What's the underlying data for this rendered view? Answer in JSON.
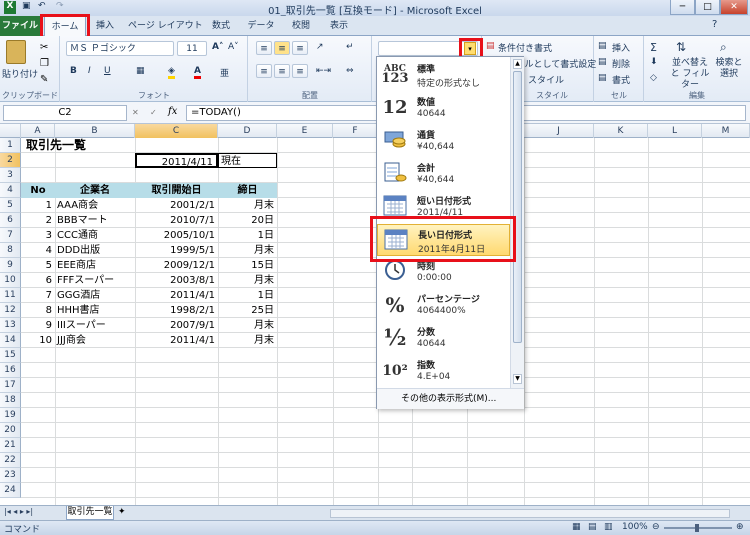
{
  "window": {
    "title": "01_取引先一覧 [互換モード] - Microsoft Excel"
  },
  "tabs": [
    "ファイル",
    "ホーム",
    "挿入",
    "ページ レイアウト",
    "数式",
    "データ",
    "校閲",
    "表示"
  ],
  "ribbon": {
    "clipboard": {
      "paste": "貼り付け",
      "label": "クリップボード"
    },
    "font": {
      "name": "ＭＳ Ｐゴシック",
      "size": "11",
      "label": "フォント"
    },
    "alignment": {
      "label": "配置"
    },
    "styles": {
      "conditional": "条件付き書式",
      "table": "テーブルとして書式設定",
      "cell": "スタイル",
      "label": "スタイル"
    },
    "cells": {
      "insert": "挿入",
      "delete": "削除",
      "format": "書式",
      "label": "セル"
    },
    "editing": {
      "sort": "並べ替えと フィルター",
      "find": "検索と 選択",
      "label": "編集"
    }
  },
  "formula_bar": {
    "name_box": "C2",
    "fx": "fx",
    "formula": "=TODAY()"
  },
  "columns": [
    "A",
    "B",
    "C",
    "D",
    "E",
    "F",
    "G",
    "H",
    "I",
    "J",
    "K",
    "L",
    "M"
  ],
  "rows": [
    "1",
    "2",
    "3",
    "4",
    "5",
    "6",
    "7",
    "8",
    "9",
    "10",
    "11",
    "12",
    "13",
    "14",
    "15",
    "16",
    "17",
    "18",
    "19",
    "20",
    "21",
    "22",
    "23",
    "24"
  ],
  "sheet": {
    "title": "取引先一覧",
    "c2": "2011/4/11",
    "d2": "現在",
    "headers": [
      "No",
      "企業名",
      "取引開始日",
      "締日"
    ],
    "data": [
      [
        "1",
        "AAA商会",
        "2001/2/1",
        "月末"
      ],
      [
        "2",
        "BBBマート",
        "2010/7/1",
        "20日"
      ],
      [
        "3",
        "CCC通商",
        "2005/10/1",
        "1日"
      ],
      [
        "4",
        "DDD出版",
        "1999/5/1",
        "月末"
      ],
      [
        "5",
        "EEE商店",
        "2009/12/1",
        "15日"
      ],
      [
        "6",
        "FFFスーパー",
        "2003/8/1",
        "月末"
      ],
      [
        "7",
        "GGG酒店",
        "2011/4/1",
        "1日"
      ],
      [
        "8",
        "HHH書店",
        "1998/2/1",
        "25日"
      ],
      [
        "9",
        "IIIスーパー",
        "2007/9/1",
        "月末"
      ],
      [
        "10",
        "JJJ商会",
        "2011/4/1",
        "月末"
      ]
    ]
  },
  "number_formats": [
    {
      "icon": "ABC 123",
      "name": "標準",
      "value": "特定の形式なし"
    },
    {
      "icon": "12",
      "name": "数値",
      "value": "40644"
    },
    {
      "icon": "currency",
      "name": "通貨",
      "value": "¥40,644"
    },
    {
      "icon": "accounting",
      "name": "会計",
      "value": " ¥40,644"
    },
    {
      "icon": "calendar",
      "name": "短い日付形式",
      "value": "2011/4/11"
    },
    {
      "icon": "calendar",
      "name": "長い日付形式",
      "value": "2011年4月11日"
    },
    {
      "icon": "clock",
      "name": "時刻",
      "value": "0:00:00"
    },
    {
      "icon": "%",
      "name": "パーセンテージ",
      "value": "4064400%"
    },
    {
      "icon": "½",
      "name": "分数",
      "value": "40644"
    },
    {
      "icon": "10²",
      "name": "指数",
      "value": "4.E+04"
    }
  ],
  "more_formats": "その他の表示形式(M)...",
  "sheet_tab": "取引先一覧",
  "status": {
    "mode": "コマンド",
    "zoom": "100%"
  }
}
